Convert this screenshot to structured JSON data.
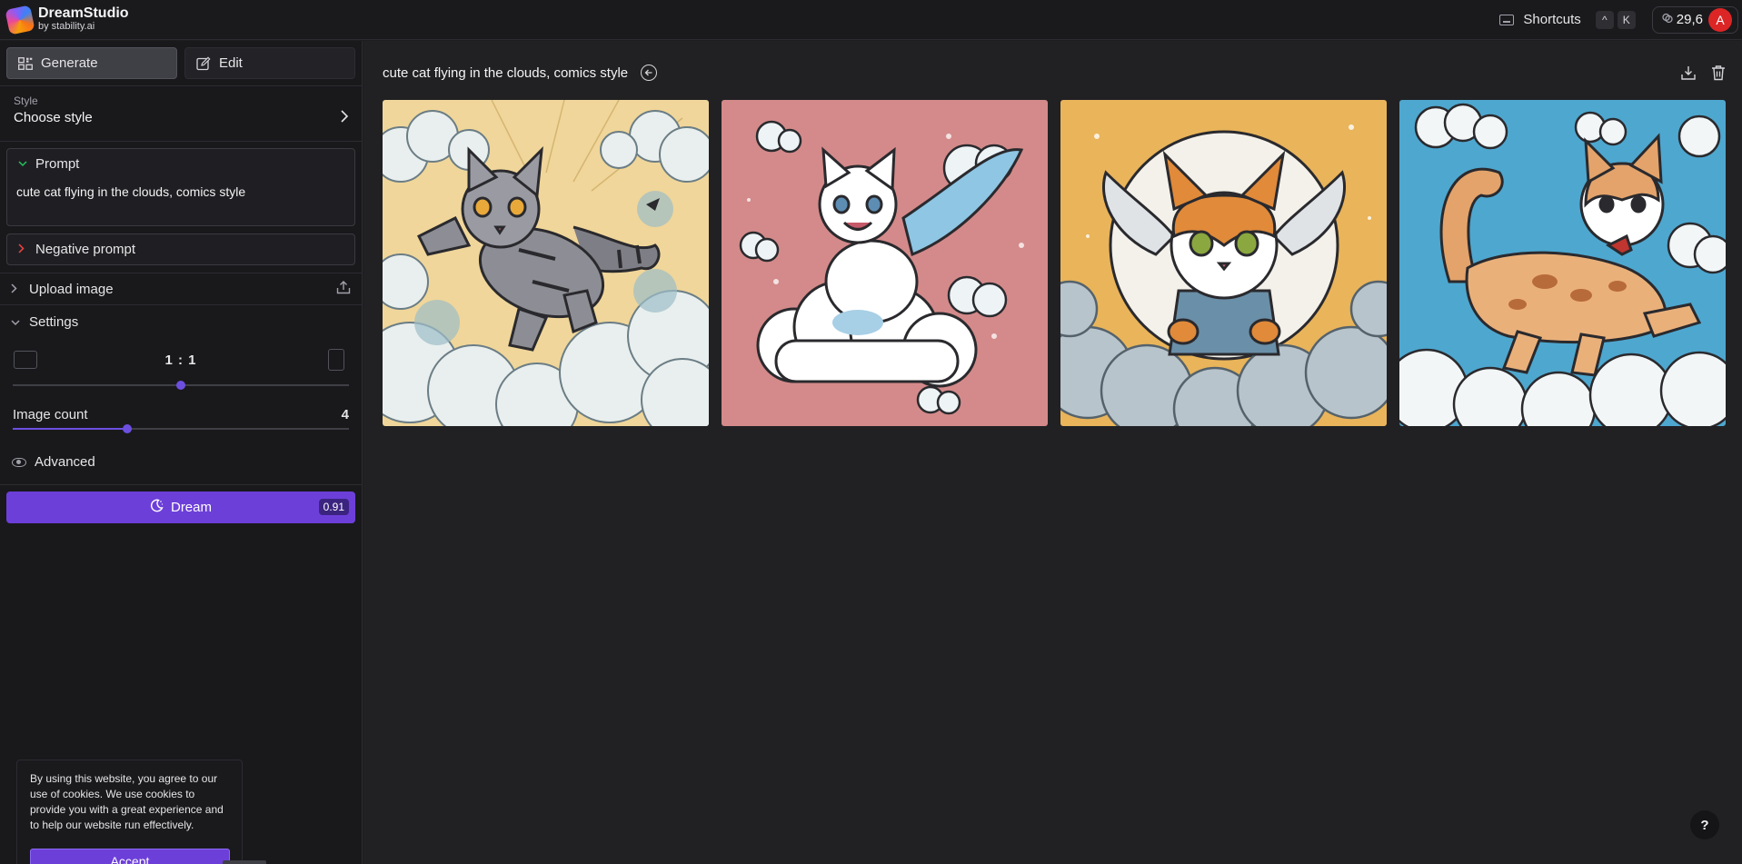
{
  "app": {
    "title": "DreamStudio",
    "subtitle": "by stability.ai"
  },
  "topbar": {
    "shortcuts_label": "Shortcuts",
    "shortcut_keys": [
      "^",
      "K"
    ],
    "credits": "29,6",
    "avatar_initial": "A"
  },
  "sidebar": {
    "modes": [
      {
        "label": "Generate",
        "active": true,
        "icon": "grid-icon"
      },
      {
        "label": "Edit",
        "active": false,
        "icon": "edit-icon"
      }
    ],
    "style": {
      "label": "Style",
      "value": "Choose style"
    },
    "prompt": {
      "label": "Prompt",
      "text": "cute cat flying in the clouds, comics style"
    },
    "negative_prompt": {
      "label": "Negative prompt"
    },
    "upload_image": {
      "label": "Upload image"
    },
    "settings": {
      "label": "Settings",
      "aspect_ratio": "1 : 1",
      "aspect_position": 0.5,
      "image_count_label": "Image count",
      "image_count": "4",
      "image_count_position": 0.34
    },
    "advanced": {
      "label": "Advanced"
    },
    "dream": {
      "label": "Dream",
      "cost": "0.91"
    }
  },
  "main": {
    "generation_title": "cute cat flying in the clouds, comics style",
    "images": [
      {
        "name": "gray-tabby-cat-image",
        "bg": "#f0d69a"
      },
      {
        "name": "winged-white-cat-image",
        "bg": "#d48a8a"
      },
      {
        "name": "orange-cat-jacket-image",
        "bg": "#e9b45a"
      },
      {
        "name": "orange-cat-blue-sky-image",
        "bg": "#4ea7cf"
      }
    ]
  },
  "cookie": {
    "text": "By using this website, you agree to our use of cookies. We use cookies to provide you with a great experience and to help our website run effectively.",
    "accept_label": "Accept"
  },
  "help_label": "?",
  "colors": {
    "accent": "#6d3fd9",
    "background": "#1d1d20"
  }
}
